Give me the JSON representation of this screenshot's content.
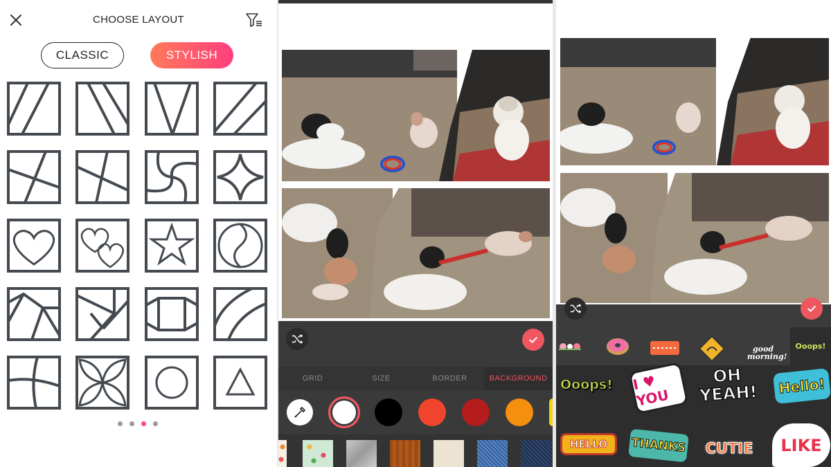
{
  "screen1": {
    "title": "CHOOSE LAYOUT",
    "icons": {
      "close": "close-icon",
      "filter": "filter-icon"
    },
    "segments": {
      "classic": "CLASSIC",
      "stylish": "STYLISH",
      "selected": "STYLISH"
    },
    "layout_tiles": [
      "diagonal-lines-right",
      "diagonal-lines-left",
      "triangle-v",
      "diagonal-corner",
      "x-split-offset",
      "x-split",
      "pinwheel-curves",
      "four-point-star",
      "heart",
      "double-heart",
      "star",
      "yin-yang",
      "pentagon-split",
      "triangle-pinwheel",
      "hexagon-band",
      "arc-corner",
      "wavy-quad",
      "petal-cross",
      "circle",
      "triangle"
    ],
    "pagination": {
      "total": 4,
      "current": 3
    },
    "colors": {
      "accent_start": "#ff7a5a",
      "accent_end": "#ff3f7e",
      "line": "#444a50"
    }
  },
  "screen2": {
    "tabs": [
      "GRID",
      "SIZE",
      "BORDER",
      "BACKGROUND"
    ],
    "active_tab": "BACKGROUND",
    "icons": {
      "shuffle": "shuffle-icon",
      "confirm": "checkmark-icon",
      "eyedropper": "eyedropper-icon"
    },
    "swatches": [
      "#ffffff",
      "#000000",
      "#f0442c",
      "#b51c1c",
      "#f5900f",
      "#f4d21a"
    ],
    "selected_swatch": "#ffffff",
    "textures": [
      "floral",
      "stars-pattern",
      "silver-tile",
      "wood",
      "paper",
      "denim-blue",
      "denim-dark"
    ]
  },
  "screen3": {
    "icons": {
      "shuffle": "shuffle-icon",
      "confirm": "checkmark-icon"
    },
    "sticker_categories": [
      "flowers",
      "donut",
      "rating-bubble",
      "sign",
      "good morning!",
      "Ooops!"
    ],
    "stickers": [
      "Ooops!",
      "I ♥ YOU",
      "OH YEAH!",
      "Hello!",
      "HELLO",
      "THANKS",
      "CUTIE",
      "LIKE"
    ]
  }
}
